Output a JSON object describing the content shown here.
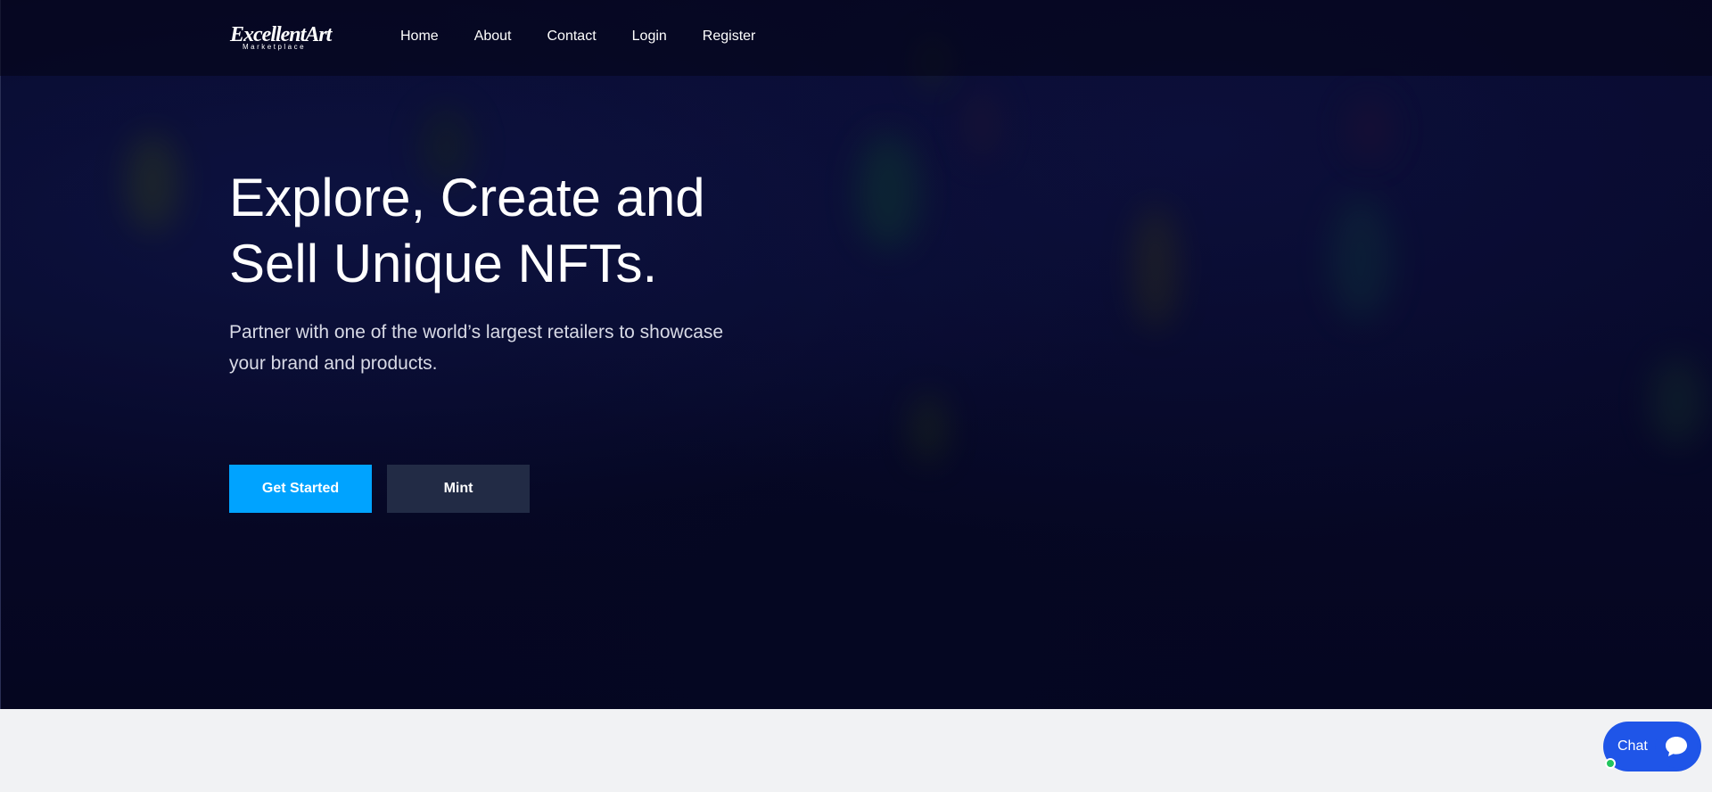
{
  "brand": {
    "logo_main": "ExcellentArt",
    "logo_sub": "Marketplace"
  },
  "nav": {
    "items": [
      "Home",
      "About",
      "Contact",
      "Login",
      "Register"
    ]
  },
  "hero": {
    "title": "Explore, Create and Sell Unique NFTs.",
    "subtitle": "Partner with one of the world’s largest retailers to showcase your brand and products.",
    "primary_button": "Get Started",
    "secondary_button": "Mint"
  },
  "chat": {
    "label": "Chat",
    "icon": "speech-bubble-icon",
    "status": "online"
  },
  "colors": {
    "hero_bg": "#07092a",
    "primary": "#00a3ff",
    "secondary": "#222b45",
    "chat": "#1f55e8",
    "online": "#22c55e"
  }
}
